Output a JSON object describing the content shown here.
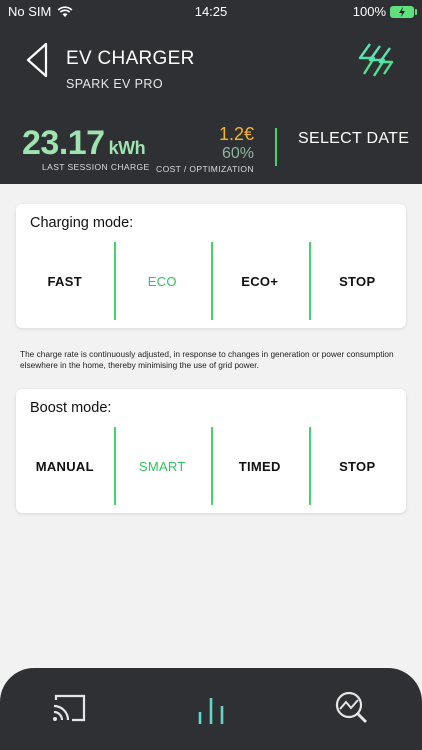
{
  "status": {
    "carrier": "No SIM",
    "time": "14:25",
    "battery": "100%"
  },
  "header": {
    "title": "EV CHARGER",
    "subtitle": "SPARK EV PRO",
    "charge_value": "23.17",
    "charge_unit": "kWh",
    "charge_label": "LAST SESSION CHARGE",
    "cost": "1.2€",
    "optimization": "60%",
    "cost_label": "COST / OPTIMIZATION",
    "select_date": "SELECT DATE"
  },
  "charging_mode": {
    "title": "Charging mode:",
    "options": [
      "FAST",
      "ECO",
      "ECO+",
      "STOP"
    ],
    "selected": "ECO"
  },
  "description": "The charge rate is continuously adjusted, in response to changes in generation or power consumption elsewhere in the home, thereby minimising the use of grid power.",
  "boost_mode": {
    "title": "Boost mode:",
    "options": [
      "MANUAL",
      "SMART",
      "TIMED",
      "STOP"
    ],
    "selected": "SMART"
  },
  "nav": {
    "items": [
      "cast-icon",
      "bar-chart-icon",
      "analytics-search-icon"
    ],
    "active": "bar-chart-icon"
  },
  "colors": {
    "header_bg": "#2f3033",
    "accent_green": "#43d26b",
    "cost_orange": "#f2b530",
    "charge_green": "#9fe3b0"
  }
}
